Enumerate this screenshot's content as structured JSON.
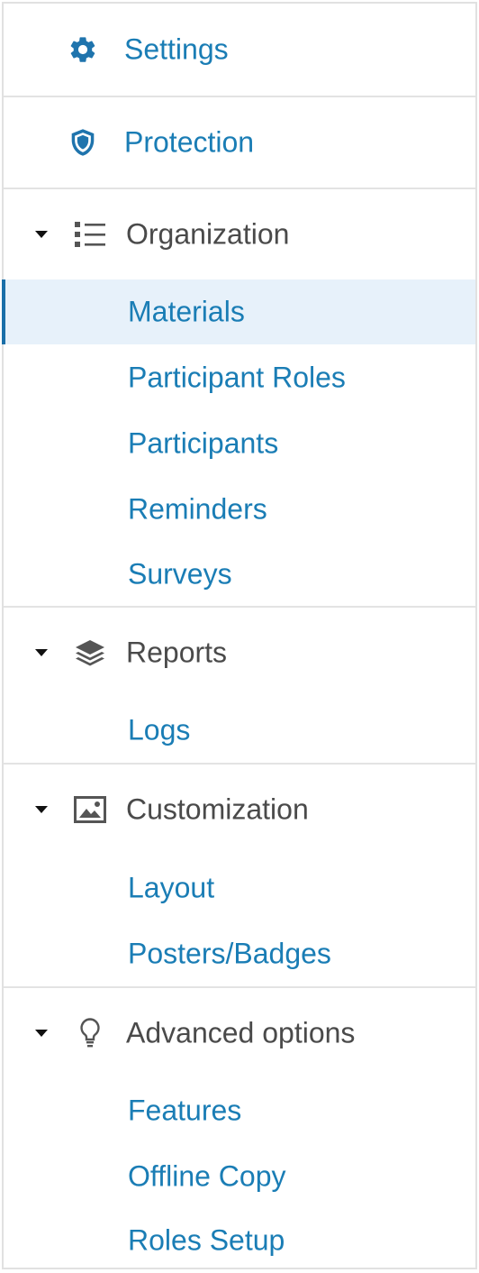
{
  "nav": {
    "top_links": [
      {
        "label": "Settings",
        "icon": "gear-icon"
      },
      {
        "label": "Protection",
        "icon": "shield-icon"
      }
    ],
    "groups": [
      {
        "label": "Organization",
        "icon": "list-icon",
        "items": [
          {
            "label": "Materials",
            "active": true
          },
          {
            "label": "Participant Roles"
          },
          {
            "label": "Participants"
          },
          {
            "label": "Reminders"
          },
          {
            "label": "Surveys"
          }
        ]
      },
      {
        "label": "Reports",
        "icon": "layers-icon",
        "items": [
          {
            "label": "Logs"
          }
        ]
      },
      {
        "label": "Customization",
        "icon": "image-icon",
        "items": [
          {
            "label": "Layout"
          },
          {
            "label": "Posters/Badges"
          }
        ]
      },
      {
        "label": "Advanced options",
        "icon": "lightbulb-icon",
        "items": [
          {
            "label": "Features"
          },
          {
            "label": "Offline Copy"
          },
          {
            "label": "Roles Setup"
          }
        ]
      }
    ]
  },
  "colors": {
    "link": "#1a7db5",
    "header_text": "#4a4a4a",
    "active_bg": "#e7f1fa",
    "active_bar": "#1a6fa8",
    "icon_blue": "#1f74ad",
    "icon_gray": "#555555",
    "border": "#e1e1e1"
  }
}
